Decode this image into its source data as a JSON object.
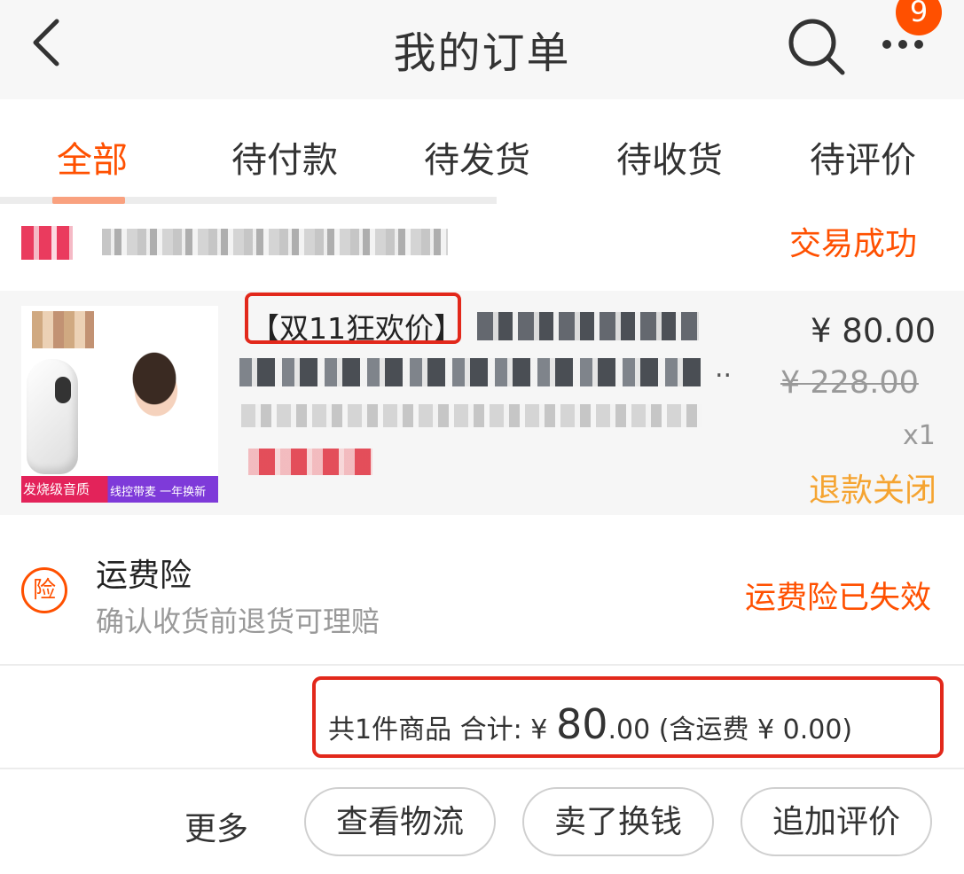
{
  "header": {
    "title": "我的订单",
    "badge_count": "9"
  },
  "tabs": [
    {
      "label": "全部",
      "active": true
    },
    {
      "label": "待付款"
    },
    {
      "label": "待发货"
    },
    {
      "label": "待收货"
    },
    {
      "label": "待评价"
    }
  ],
  "order": {
    "status": "交易成功",
    "item": {
      "promo_tag": "【双11狂欢价】",
      "price": "¥ 80.00",
      "original_price": "¥ 228.00",
      "quantity": "x1",
      "refund_status": "退款关闭",
      "image_tags": [
        "发烧级音质",
        "线控带麦 一年换新"
      ],
      "title_ellipsis": ".."
    },
    "insurance": {
      "icon_char": "险",
      "title": "运费险",
      "description": "确认收货前退货可理赔",
      "status": "运费险已失效"
    },
    "total": {
      "count_text": "共1件商品",
      "label": "合计:",
      "currency": "¥",
      "amount_int": "80",
      "amount_dec": ".00",
      "shipping_text": "(含运费 ¥ 0.00)"
    },
    "actions": {
      "more": "更多",
      "buttons": [
        "查看物流",
        "卖了换钱",
        "追加评价"
      ]
    }
  },
  "colors": {
    "accent": "#ff5000",
    "refund": "#f5a431",
    "highlight_box": "#e2281b"
  }
}
